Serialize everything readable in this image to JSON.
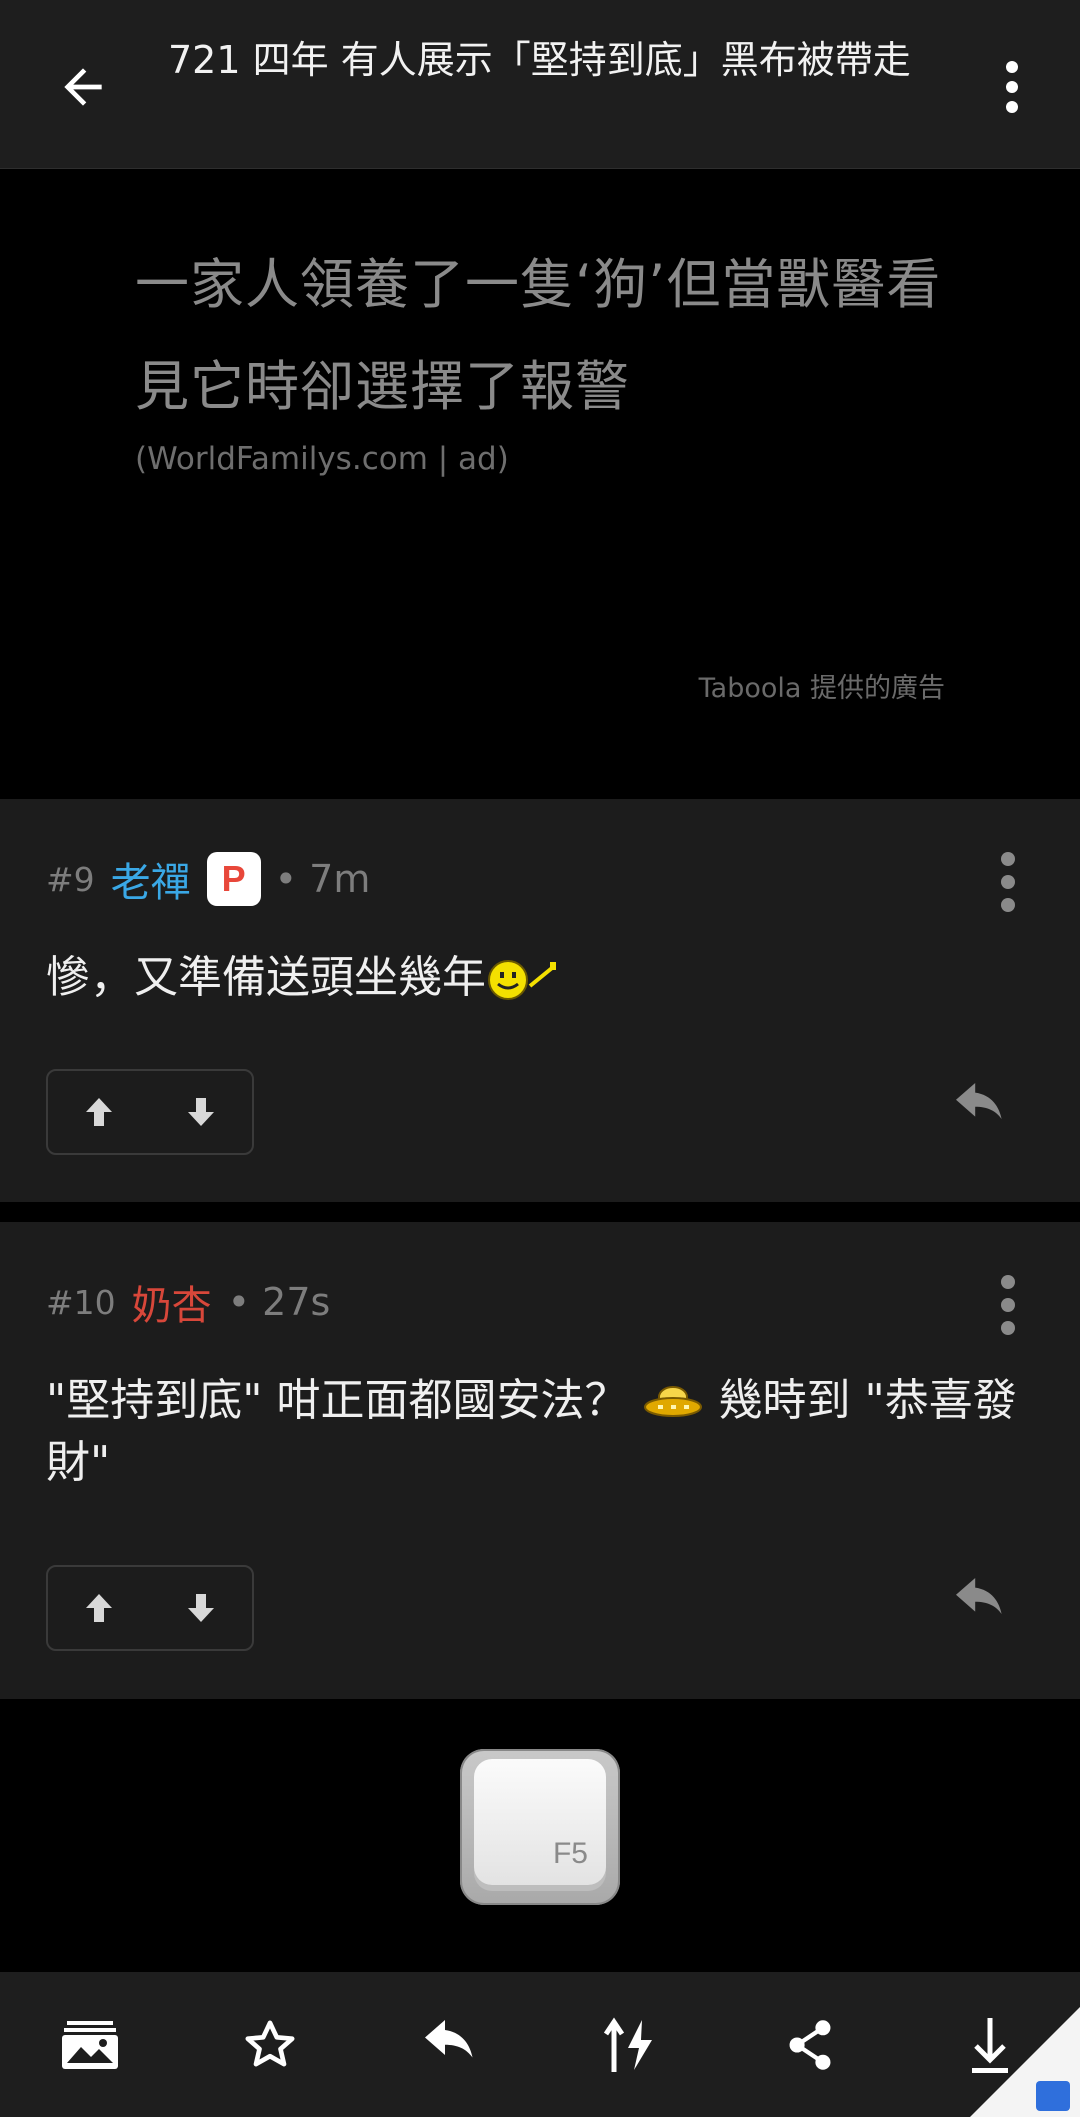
{
  "header": {
    "title": "721 四年 有人展示「堅持到底」黑布被帶走",
    "back_icon": "arrow-left-icon",
    "more_icon": "more-vertical-icon"
  },
  "ad": {
    "headline": "一家人領養了一隻‘狗’但當獸醫看見它時卻選擇了報警",
    "source": "(WorldFamilys.com | ad)",
    "provider": "Taboola 提供的廣告"
  },
  "comments": [
    {
      "floor": "#9",
      "author": "老禪",
      "author_color": "#3aa8e6",
      "badge": "P",
      "time": "• 7m",
      "body": "慘，又準備送頭坐幾年"
    },
    {
      "floor": "#10",
      "author": "奶杏",
      "author_color": "#d8473a",
      "time": "• 27s",
      "body_part1": "\"堅持到底\" 咁正面都國安法？",
      "body_part2": "幾時到 \"恭喜發財\""
    }
  ],
  "refresh": {
    "key_label": "F5"
  },
  "toolbar": {
    "items": [
      "gallery-icon",
      "star-icon",
      "reply-icon",
      "sort-flash-icon",
      "share-icon",
      "download-icon"
    ]
  },
  "colors": {
    "background": "#000000",
    "card": "#1c1c1c",
    "bar": "#1e1e1e"
  }
}
